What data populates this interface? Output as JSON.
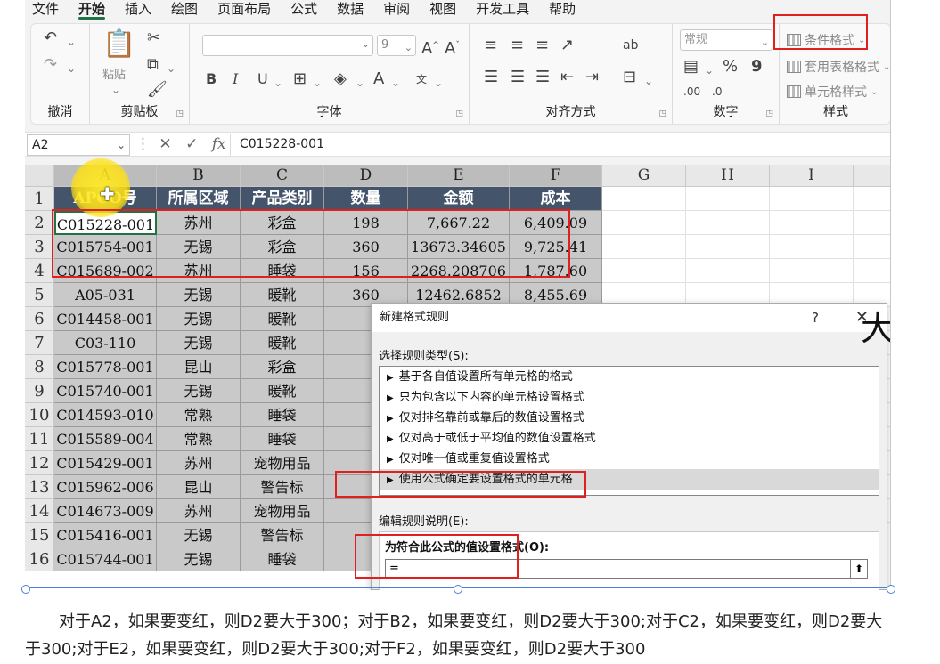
{
  "menu": [
    "文件",
    "开始",
    "插入",
    "绘图",
    "页面布局",
    "公式",
    "数据",
    "审阅",
    "视图",
    "开发工具",
    "帮助"
  ],
  "menu_active": "开始",
  "ribbon": {
    "groups": [
      "撤消",
      "剪贴板",
      "字体",
      "对齐方式",
      "数字",
      "样式"
    ],
    "paste_label": "粘贴",
    "font_size": "9",
    "font_bold": "B",
    "font_italic": "I",
    "font_underline": "U",
    "font_color": "A",
    "number_format": "常规",
    "percent": "%",
    "comma": "9",
    "styles": [
      "条件格式",
      "套用表格格式",
      "单元格样式"
    ]
  },
  "formula_bar": {
    "name_box": "A2",
    "cancel": "✕",
    "confirm": "✓",
    "fx": "fx",
    "value": "C015228-001"
  },
  "columns": [
    "A",
    "B",
    "C",
    "D",
    "E",
    "F",
    "G",
    "H",
    "I"
  ],
  "rows": [
    "1",
    "2",
    "3",
    "4",
    "5",
    "6",
    "7",
    "8",
    "9",
    "10",
    "11",
    "12",
    "13",
    "14",
    "15",
    "16"
  ],
  "table": {
    "headers": [
      "APCO号",
      "所属区域",
      "产品类别",
      "数量",
      "金额",
      "成本"
    ],
    "rows": [
      [
        "C015228-001",
        "苏州",
        "彩盒",
        "198",
        "7,667.22",
        "6,409.09"
      ],
      [
        "C015754-001",
        "无锡",
        "彩盒",
        "360",
        "13673.34605",
        "9,725.41"
      ],
      [
        "C015689-002",
        "苏州",
        "睡袋",
        "156",
        "2268.208706",
        "1,787.60"
      ],
      [
        "A05-031",
        "无锡",
        "暖靴",
        "360",
        "12462.6852",
        "8,455.69"
      ],
      [
        "C014458-001",
        "无锡",
        "暖靴",
        "",
        "",
        ""
      ],
      [
        "C03-110",
        "无锡",
        "暖靴",
        "",
        "",
        ""
      ],
      [
        "C015778-001",
        "昆山",
        "彩盒",
        "",
        "",
        ""
      ],
      [
        "C015740-001",
        "无锡",
        "暖靴",
        "",
        "",
        ""
      ],
      [
        "C014593-010",
        "常熟",
        "睡袋",
        "",
        "",
        ""
      ],
      [
        "C015589-004",
        "常熟",
        "睡袋",
        "",
        "",
        ""
      ],
      [
        "C015429-001",
        "苏州",
        "宠物用品",
        "",
        "",
        ""
      ],
      [
        "C015962-006",
        "昆山",
        "警告标",
        "",
        "",
        ""
      ],
      [
        "C014673-009",
        "苏州",
        "宠物用品",
        "",
        "",
        ""
      ],
      [
        "C015416-001",
        "无锡",
        "警告标",
        "",
        "",
        ""
      ],
      [
        "C015744-001",
        "无锡",
        "睡袋",
        "",
        "",
        ""
      ]
    ]
  },
  "big_char": "大",
  "dialog": {
    "title": "新建格式规则",
    "help": "?",
    "close": "✕",
    "select_type_label": "选择规则类型(S):",
    "rule_types": [
      "基于各自值设置所有单元格的格式",
      "只为包含以下内容的单元格设置格式",
      "仅对排名靠前或靠后的数值设置格式",
      "仅对高于或低于平均值的数值设置格式",
      "仅对唯一值或重复值设置格式",
      "使用公式确定要设置格式的单元格"
    ],
    "selected_index": 5,
    "edit_desc_label": "编辑规则说明(E):",
    "formula_label": "为符合此公式的值设置格式(O):",
    "formula_value": "=",
    "collapse": "⬆"
  },
  "caption": "对于A2，如果要变红，则D2要大于300；对于B2，如果要变红，则D2要大于300;对于C2，如果要变红，则D2要大于300;对于E2，如果要变红，则D2要大于300;对于F2，如果要变红，则D2要大于300",
  "colors": {
    "accent": "#217346",
    "highlight": "#e02020",
    "header_fill": "#44546a",
    "cell_fill": "#c9c9c9"
  }
}
